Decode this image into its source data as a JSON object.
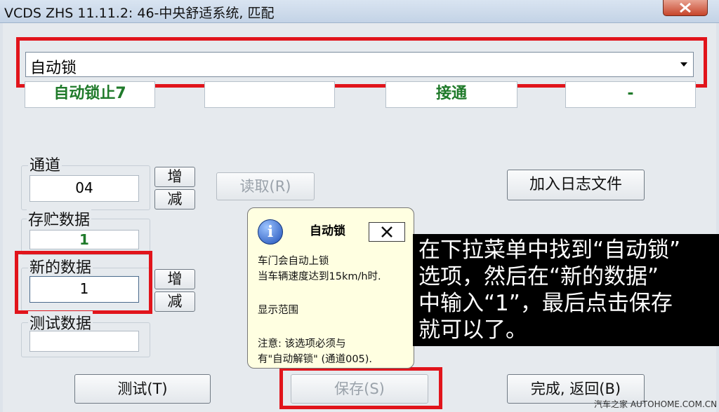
{
  "window": {
    "title": "VCDS ZHS 11.11.2: 46-中央舒适系统, 匹配"
  },
  "selector": {
    "selected": "自动锁"
  },
  "values": [
    "自动锁止7",
    "",
    "接通",
    "-"
  ],
  "channel": {
    "label": "通道",
    "value": "04",
    "inc": "增",
    "dec": "减"
  },
  "read_button": "读取(R)",
  "log_button": "加入日志文件",
  "stored": {
    "label": "存贮数据",
    "value": "1"
  },
  "new_data": {
    "label": "新的数据",
    "value": "1",
    "inc": "增",
    "dec": "减"
  },
  "test_data": {
    "label": "测试数据",
    "value": ""
  },
  "tooltip": {
    "title": "自动锁",
    "lines": [
      "车门会自动上锁",
      "当车辆速度达到15km/h时.",
      "显示范围",
      "注意: 该选项必须与",
      "有\"自动解锁\" (通道005)."
    ]
  },
  "buttons": {
    "test": "测试(T)",
    "save": "保存(S)",
    "done": "完成, 返回(B)"
  },
  "annotation": {
    "lines": [
      "在下拉菜单中找到“自动锁”",
      "选项，然后在“新的数据”",
      "中输入“1”，最后点击保存",
      "就可以了。"
    ]
  },
  "watermark": "汽车之家 AUTOHOME.COM.CN",
  "colors": {
    "highlight": "#e1141b",
    "value_green": "#1f7a2a"
  }
}
